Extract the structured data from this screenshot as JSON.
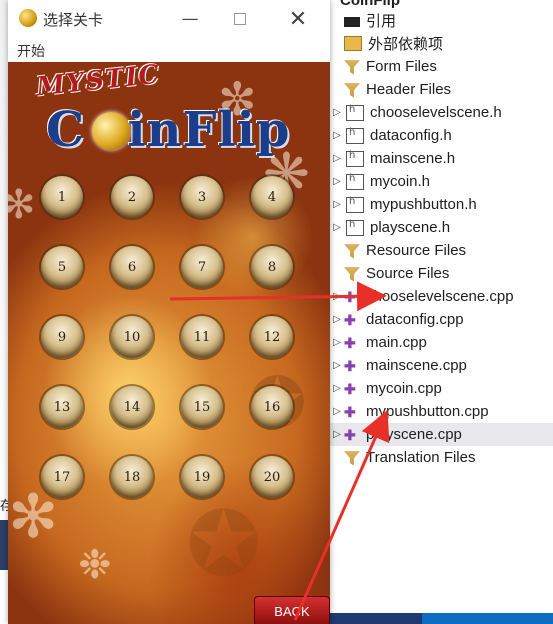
{
  "solution_explorer": {
    "project_title": "CoinFlip",
    "items": [
      {
        "label": "引用",
        "icon": "reference-icon",
        "arrow": "",
        "kind": "ref"
      },
      {
        "label": "外部依赖项",
        "icon": "external-dependencies-icon",
        "arrow": "",
        "kind": "ext"
      },
      {
        "label": "Form Files",
        "icon": "filter-folder-icon",
        "arrow": "",
        "kind": "filter"
      },
      {
        "label": "Header Files",
        "icon": "filter-folder-icon",
        "arrow": "",
        "kind": "filter"
      },
      {
        "label": "chooselevelscene.h",
        "icon": "header-file-icon",
        "arrow": "▷",
        "kind": "hfile"
      },
      {
        "label": "dataconfig.h",
        "icon": "header-file-icon",
        "arrow": "▷",
        "kind": "hfile"
      },
      {
        "label": "mainscene.h",
        "icon": "header-file-icon",
        "arrow": "▷",
        "kind": "hfile"
      },
      {
        "label": "mycoin.h",
        "icon": "header-file-icon",
        "arrow": "▷",
        "kind": "hfile"
      },
      {
        "label": "mypushbutton.h",
        "icon": "header-file-icon",
        "arrow": "▷",
        "kind": "hfile"
      },
      {
        "label": "playscene.h",
        "icon": "header-file-icon",
        "arrow": "▷",
        "kind": "hfile"
      },
      {
        "label": "Resource Files",
        "icon": "filter-folder-icon",
        "arrow": "",
        "kind": "filter"
      },
      {
        "label": "Source Files",
        "icon": "filter-folder-icon",
        "arrow": "",
        "kind": "filter"
      },
      {
        "label": "chooselevelscene.cpp",
        "icon": "cpp-file-icon",
        "arrow": "▷",
        "kind": "cpp"
      },
      {
        "label": "dataconfig.cpp",
        "icon": "cpp-file-icon",
        "arrow": "▷",
        "kind": "cpp"
      },
      {
        "label": "main.cpp",
        "icon": "cpp-file-icon",
        "arrow": "▷",
        "kind": "cpp"
      },
      {
        "label": "mainscene.cpp",
        "icon": "cpp-file-icon",
        "arrow": "▷",
        "kind": "cpp"
      },
      {
        "label": "mycoin.cpp",
        "icon": "cpp-file-icon",
        "arrow": "▷",
        "kind": "cpp"
      },
      {
        "label": "mypushbutton.cpp",
        "icon": "cpp-file-icon",
        "arrow": "▷",
        "kind": "cpp"
      },
      {
        "label": "playscene.cpp",
        "icon": "cpp-file-icon",
        "arrow": "▷",
        "kind": "cpp",
        "selected": true
      },
      {
        "label": "Translation Files",
        "icon": "filter-folder-icon",
        "arrow": "",
        "kind": "filter"
      }
    ]
  },
  "window": {
    "title": "选择关卡",
    "menu_item": "开始",
    "minimize_glyph": "—",
    "close_glyph": "✕"
  },
  "game": {
    "logo_top": "MYSTIC",
    "logo_main_left": "C",
    "logo_main_right": "inFlip",
    "levels": [
      "1",
      "2",
      "3",
      "4",
      "5",
      "6",
      "7",
      "8",
      "9",
      "10",
      "11",
      "12",
      "13",
      "14",
      "15",
      "16",
      "17",
      "18",
      "19",
      "20"
    ],
    "back_label": "BACK"
  },
  "left_edge_fragment": "存",
  "colors": {
    "arrow": "#e8302a",
    "selected_row": "#e8e8ec",
    "title_blue": "#1c3d8a",
    "back_red": "#c41e1e"
  }
}
